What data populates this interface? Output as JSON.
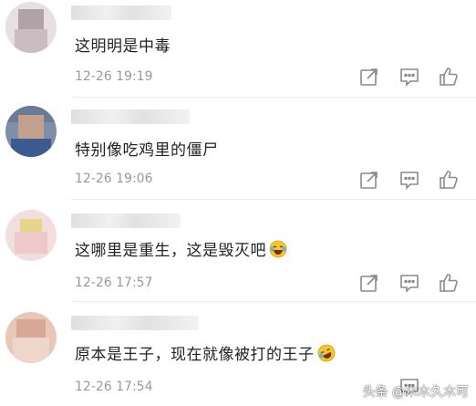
{
  "comments": [
    {
      "text": "这明明是中毒",
      "time": "12-26 19:19",
      "emoji": ""
    },
    {
      "text": "特别像吃鸡里的僵尸",
      "time": "12-26 19:06",
      "emoji": ""
    },
    {
      "text": "这哪里是重生，这是毁灭吧",
      "time": "12-26 17:57",
      "emoji": "laughing-tears-emoji"
    },
    {
      "text": "原本是王子，现在就像被打的王子",
      "time": "12-26 17:54",
      "emoji": "rolling-laughing-emoji"
    }
  ],
  "actions": {
    "forward_icon": "share-arrow-icon",
    "reply_icon": "comment-bubble-icon",
    "like_icon": "thumbs-up-icon"
  },
  "colors": {
    "text": "#222222",
    "time": "#999999",
    "icon": "#8a8a8a",
    "divider": "#ececec"
  },
  "watermark": "头条 @木木久木可"
}
